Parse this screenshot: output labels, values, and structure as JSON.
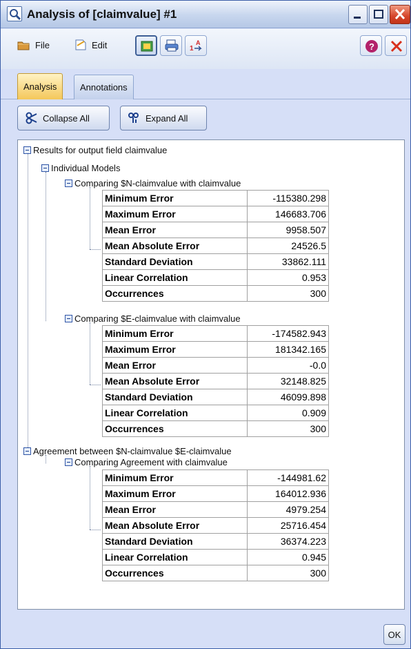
{
  "window": {
    "title": "Analysis of [claimvalue] #1"
  },
  "toolbar": {
    "file_label": "File",
    "edit_label": "Edit"
  },
  "tabs": [
    {
      "label": "Analysis",
      "active": true
    },
    {
      "label": "Annotations",
      "active": false
    }
  ],
  "actions": {
    "collapse_label": "Collapse All",
    "expand_label": "Expand All"
  },
  "tree": {
    "root_label": "Results for output field claimvalue",
    "individual_label": "Individual Models",
    "models": [
      {
        "label": "Comparing $N-claimvalue with claimvalue",
        "rows": [
          {
            "k": "Minimum Error",
            "v": "-115380.298"
          },
          {
            "k": "Maximum Error",
            "v": "146683.706"
          },
          {
            "k": "Mean Error",
            "v": "9958.507"
          },
          {
            "k": "Mean Absolute Error",
            "v": "24526.5"
          },
          {
            "k": "Standard Deviation",
            "v": "33862.111"
          },
          {
            "k": "Linear Correlation",
            "v": "0.953"
          },
          {
            "k": "Occurrences",
            "v": "300"
          }
        ]
      },
      {
        "label": "Comparing $E-claimvalue with claimvalue",
        "rows": [
          {
            "k": "Minimum Error",
            "v": "-174582.943"
          },
          {
            "k": "Maximum Error",
            "v": "181342.165"
          },
          {
            "k": "Mean Error",
            "v": "-0.0"
          },
          {
            "k": "Mean Absolute Error",
            "v": "32148.825"
          },
          {
            "k": "Standard Deviation",
            "v": "46099.898"
          },
          {
            "k": "Linear Correlation",
            "v": "0.909"
          },
          {
            "k": "Occurrences",
            "v": "300"
          }
        ]
      }
    ],
    "agreement_label": "Agreement between  $N-claimvalue $E-claimvalue",
    "agreement": {
      "label": "Comparing Agreement with claimvalue",
      "rows": [
        {
          "k": "Minimum Error",
          "v": "-144981.62"
        },
        {
          "k": "Maximum Error",
          "v": "164012.936"
        },
        {
          "k": "Mean Error",
          "v": "4979.254"
        },
        {
          "k": "Mean Absolute Error",
          "v": "25716.454"
        },
        {
          "k": "Standard Deviation",
          "v": "36374.223"
        },
        {
          "k": "Linear Correlation",
          "v": "0.945"
        },
        {
          "k": "Occurrences",
          "v": "300"
        }
      ]
    }
  },
  "footer": {
    "ok_label": "OK"
  }
}
